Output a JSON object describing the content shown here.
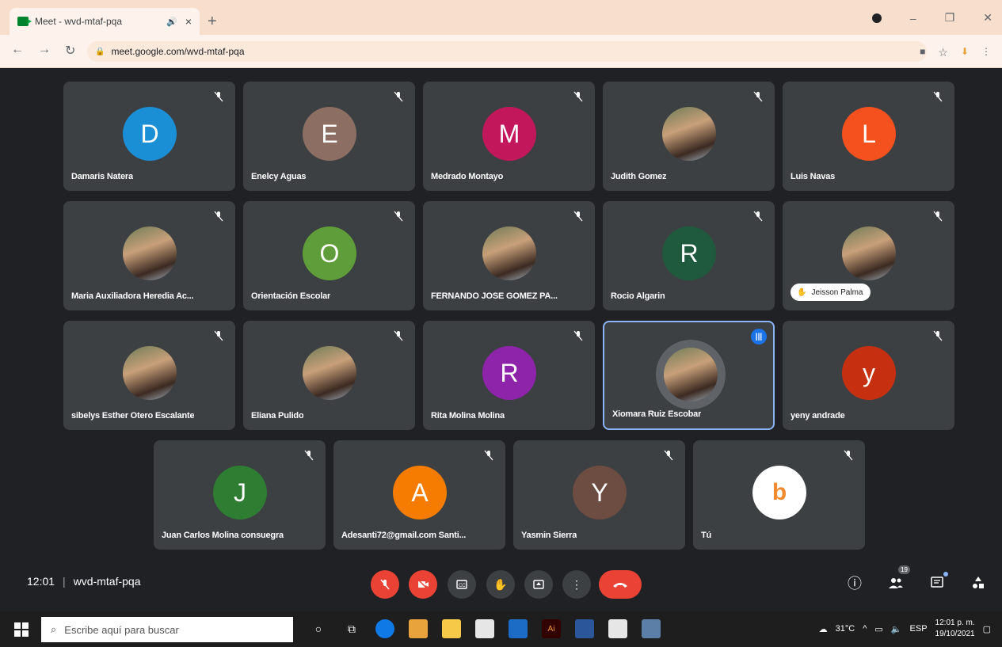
{
  "browser": {
    "tab_title": "Meet - wvd-mtaf-pqa",
    "audio_icon": "speaker-icon",
    "tab_close": "×",
    "new_tab": "+",
    "url": "meet.google.com/wvd-mtaf-pqa",
    "window_controls": [
      "record-icon",
      "minimize-icon",
      "restore-icon",
      "close-icon"
    ]
  },
  "participants": [
    {
      "name": "Damaris Natera",
      "initial": "D",
      "color": "#1a8fd6",
      "muted": true
    },
    {
      "name": "Enelcy Aguas",
      "initial": "E",
      "color": "#8d6e63",
      "muted": true
    },
    {
      "name": "Medrado Montayo",
      "initial": "M",
      "color": "#c2185b",
      "muted": true
    },
    {
      "name": "Judith Gomez",
      "initial": "",
      "color": "#6b5a4e",
      "photo": true,
      "muted": true
    },
    {
      "name": "Luis Navas",
      "initial": "L",
      "color": "#f4511e",
      "muted": true
    },
    {
      "name": "Maria Auxiliadora Heredia Ac...",
      "initial": "",
      "color": "#a37a5a",
      "photo": true,
      "muted": true
    },
    {
      "name": "Orientación Escolar",
      "initial": "O",
      "color": "#5e9d3a",
      "muted": true
    },
    {
      "name": "FERNANDO JOSE GOMEZ PA...",
      "initial": "",
      "color": "#4a6a8a",
      "photo": true,
      "muted": true
    },
    {
      "name": "Rocio Algarin",
      "initial": "R",
      "color": "#1f5a3e",
      "muted": true
    },
    {
      "name": "",
      "chip": "Jeisson Palma",
      "initial": "",
      "color": "#b9c3cc",
      "photo": true,
      "muted": true
    },
    {
      "name": "sibelys Esther Otero Escalante",
      "initial": "",
      "color": "#9fb7c8",
      "photo": true,
      "muted": true
    },
    {
      "name": "Eliana Pulido",
      "initial": "",
      "color": "#5a3b2e",
      "photo": true,
      "muted": true
    },
    {
      "name": "Rita Molina Molina",
      "initial": "R",
      "color": "#8e24aa",
      "muted": true
    },
    {
      "name": "Xiomara Ruiz Escobar",
      "initial": "",
      "color": "#6d7b56",
      "photo": true,
      "muted": false,
      "speaking": true
    },
    {
      "name": "yeny andrade",
      "initial": "y",
      "color": "#c62f10",
      "muted": true
    },
    {
      "name": "Juan Carlos Molina consuegra",
      "initial": "J",
      "color": "#2e7d32",
      "muted": true
    },
    {
      "name": "Adesanti72@gmail.com Santi...",
      "initial": "A",
      "color": "#f57c00",
      "muted": true
    },
    {
      "name": "Yasmin Sierra",
      "initial": "Y",
      "color": "#6d4c41",
      "muted": true
    },
    {
      "name": "Tú",
      "initial": "b",
      "color": "#ffffff",
      "logo": true,
      "muted": true
    }
  ],
  "meeting": {
    "time": "12:01",
    "code": "wvd-mtaf-pqa",
    "participant_count": "19"
  },
  "controls": [
    "mic-off-icon",
    "camera-off-icon",
    "captions-icon",
    "raise-hand-icon",
    "present-icon",
    "more-options-icon",
    "hang-up-icon"
  ],
  "taskbar": {
    "search_placeholder": "Escribe aquí para buscar",
    "weather": "31°C",
    "lang": "ESP",
    "time": "12:01 p. m.",
    "date": "19/10/2021"
  }
}
